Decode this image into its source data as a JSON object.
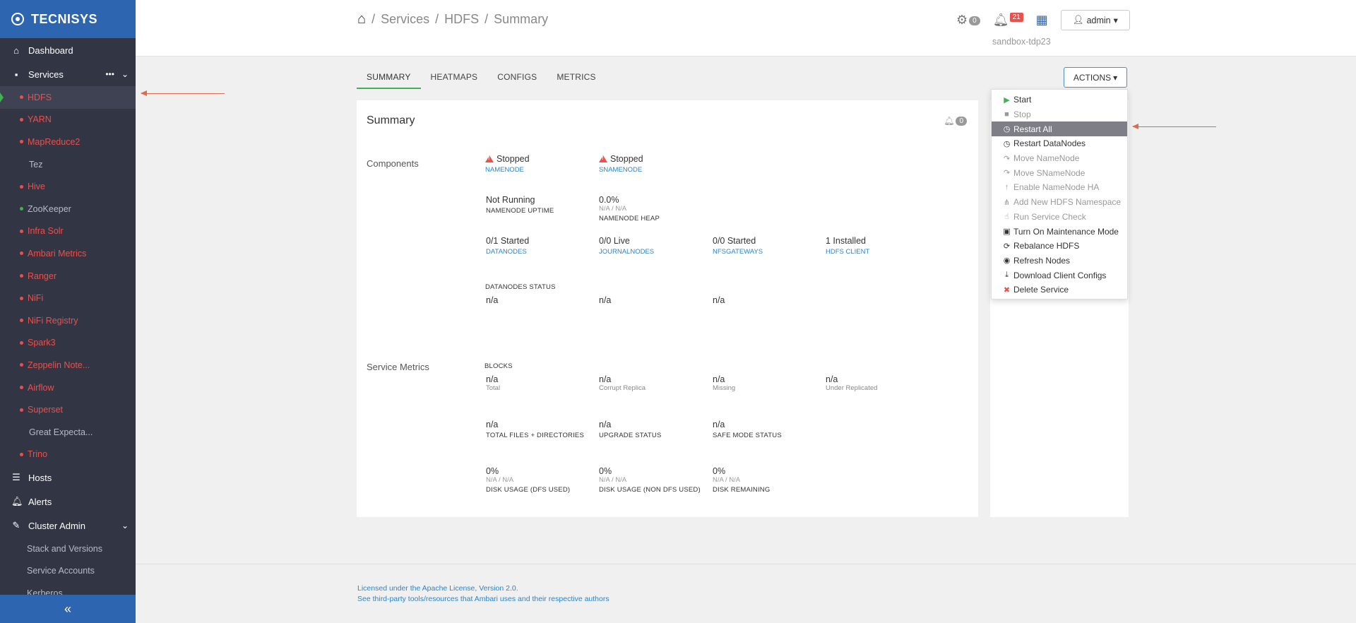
{
  "brand": "TECNISYS",
  "sidebar": {
    "dashboard": "Dashboard",
    "services": "Services",
    "services_more": "•••",
    "service_items": [
      {
        "label": "HDFS",
        "status": "red",
        "active": true
      },
      {
        "label": "YARN",
        "status": "red"
      },
      {
        "label": "MapReduce2",
        "status": "red"
      },
      {
        "label": "Tez",
        "status": "none"
      },
      {
        "label": "Hive",
        "status": "red"
      },
      {
        "label": "ZooKeeper",
        "status": "green"
      },
      {
        "label": "Infra Solr",
        "status": "red"
      },
      {
        "label": "Ambari Metrics",
        "status": "red"
      },
      {
        "label": "Ranger",
        "status": "red"
      },
      {
        "label": "NiFi",
        "status": "red"
      },
      {
        "label": "NiFi Registry",
        "status": "red"
      },
      {
        "label": "Spark3",
        "status": "red"
      },
      {
        "label": "Zeppelin Note...",
        "status": "red"
      },
      {
        "label": "Airflow",
        "status": "red"
      },
      {
        "label": "Superset",
        "status": "red"
      },
      {
        "label": "Great Expecta...",
        "status": "none"
      },
      {
        "label": "Trino",
        "status": "red"
      }
    ],
    "hosts": "Hosts",
    "alerts": "Alerts",
    "cluster_admin": "Cluster Admin",
    "cluster_items": [
      "Stack and Versions",
      "Service Accounts",
      "Kerberos"
    ],
    "collapse": "«"
  },
  "header": {
    "breadcrumb": [
      "Services",
      "HDFS",
      "Summary"
    ],
    "ops_count": "0",
    "alerts_count": "21",
    "user": "admin",
    "cluster": "sandbox-tdp23"
  },
  "tabs": [
    "SUMMARY",
    "HEATMAPS",
    "CONFIGS",
    "METRICS"
  ],
  "actions_label": "ACTIONS",
  "actions_menu": [
    {
      "label": "Start",
      "icon": "play-icon",
      "state": "normal"
    },
    {
      "label": "Stop",
      "icon": "stop-icon",
      "state": "disabled"
    },
    {
      "label": "Restart All",
      "icon": "clock-icon",
      "state": "selected"
    },
    {
      "label": "Restart DataNodes",
      "icon": "clock-icon",
      "state": "normal"
    },
    {
      "label": "Move NameNode",
      "icon": "share-icon",
      "state": "disabled"
    },
    {
      "label": "Move SNameNode",
      "icon": "share-icon",
      "state": "disabled"
    },
    {
      "label": "Enable NameNode HA",
      "icon": "arrow-up-icon",
      "state": "disabled"
    },
    {
      "label": "Add New HDFS Namespace",
      "icon": "sitemap-icon",
      "state": "disabled"
    },
    {
      "label": "Run Service Check",
      "icon": "thumbs-up-icon",
      "state": "disabled"
    },
    {
      "label": "Turn On Maintenance Mode",
      "icon": "medkit-icon",
      "state": "normal"
    },
    {
      "label": "Rebalance HDFS",
      "icon": "refresh-icon",
      "state": "normal"
    },
    {
      "label": "Refresh Nodes",
      "icon": "target-icon",
      "state": "normal"
    },
    {
      "label": "Download Client Configs",
      "icon": "download-icon",
      "state": "normal"
    },
    {
      "label": "Delete Service",
      "icon": "x-icon",
      "state": "normal"
    }
  ],
  "summary": {
    "title": "Summary",
    "alert_count": "0",
    "components_label": "Components",
    "namenode_status": "Stopped",
    "namenode_link": "NAMENODE",
    "snamenode_status": "Stopped",
    "snamenode_link": "SNAMENODE",
    "namenode_uptime_value": "Not Running",
    "namenode_uptime_label": "NAMENODE UPTIME",
    "namenode_heap_value": "0.0%",
    "namenode_heap_sub": "N/A / N/A",
    "namenode_heap_label": "NAMENODE HEAP",
    "datanodes_value": "0/1 Started",
    "datanodes_link": "DATANODES",
    "journalnodes_value": "0/0 Live",
    "journalnodes_link": "JOURNALNODES",
    "nfsgateways_value": "0/0 Started",
    "nfsgateways_link": "NFSGATEWAYS",
    "hdfsclient_value": "1 Installed",
    "hdfsclient_link": "HDFS CLIENT",
    "datanodes_status_label": "DATANODES STATUS",
    "dn_status_values": [
      "n/a",
      "n/a",
      "n/a"
    ],
    "service_metrics_label": "Service Metrics",
    "blocks_label": "BLOCKS",
    "blocks": [
      {
        "value": "n/a",
        "label": "Total"
      },
      {
        "value": "n/a",
        "label": "Corrupt Replica"
      },
      {
        "value": "n/a",
        "label": "Missing"
      },
      {
        "value": "n/a",
        "label": "Under Replicated"
      }
    ],
    "row2": [
      {
        "value": "n/a",
        "label": "TOTAL FILES + DIRECTORIES"
      },
      {
        "value": "n/a",
        "label": "UPGRADE STATUS"
      },
      {
        "value": "n/a",
        "label": "SAFE MODE STATUS"
      }
    ],
    "disk": [
      {
        "value": "0%",
        "sub": "N/A / N/A",
        "label": "DISK USAGE (DFS USED)"
      },
      {
        "value": "0%",
        "sub": "N/A / N/A",
        "label": "DISK USAGE (NON DFS USED)"
      },
      {
        "value": "0%",
        "sub": "N/A / N/A",
        "label": "DISK REMAINING"
      }
    ]
  },
  "footer": {
    "line1": "Licensed under the Apache License, Version 2.0.",
    "line2": "See third-party tools/resources that Ambari uses and their respective authors"
  },
  "colors": {
    "brand_blue": "#2d65b0",
    "sidebar_bg": "#323544",
    "status_red": "#e9514d",
    "status_green": "#3eb34f",
    "link_blue": "#2d84c8"
  }
}
